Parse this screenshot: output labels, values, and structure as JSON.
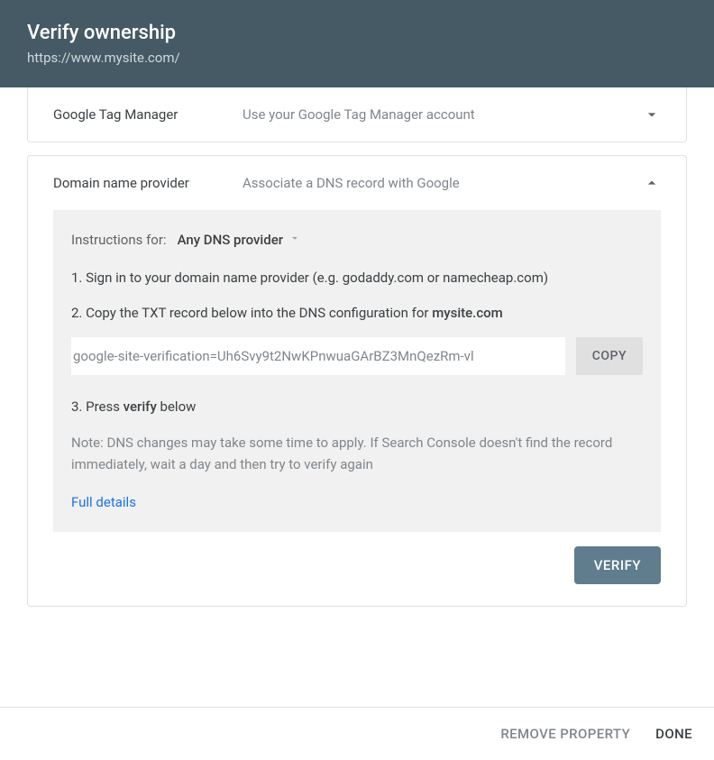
{
  "header": {
    "title": "Verify ownership",
    "subtitle": "https://www.mysite.com/"
  },
  "cards": {
    "tagManager": {
      "title": "Google Tag Manager",
      "subtitle": "Use your Google Tag Manager account"
    },
    "dns": {
      "title": "Domain name provider",
      "subtitle": "Associate a DNS record with Google",
      "instructionsLabel": "Instructions for:",
      "dropdownSelected": "Any DNS provider",
      "step1": "1. Sign in to your domain name provider (e.g. godaddy.com or namecheap.com)",
      "step2_prefix": "2. Copy the TXT record below into the DNS configuration for ",
      "step2_domain": "mysite.com",
      "txtRecord": "google-site-verification=Uh6Svy9t2NwKPnwuaGArBZ3MnQezRm-vl",
      "copyLabel": "COPY",
      "step3_prefix": "3. Press ",
      "step3_bold": "verify",
      "step3_suffix": " below",
      "note": "Note: DNS changes may take some time to apply. If Search Console doesn't find the record immediately, wait a day and then try to verify again",
      "fullDetails": "Full details",
      "verifyLabel": "VERIFY"
    }
  },
  "footer": {
    "remove": "REMOVE PROPERTY",
    "done": "DONE"
  }
}
